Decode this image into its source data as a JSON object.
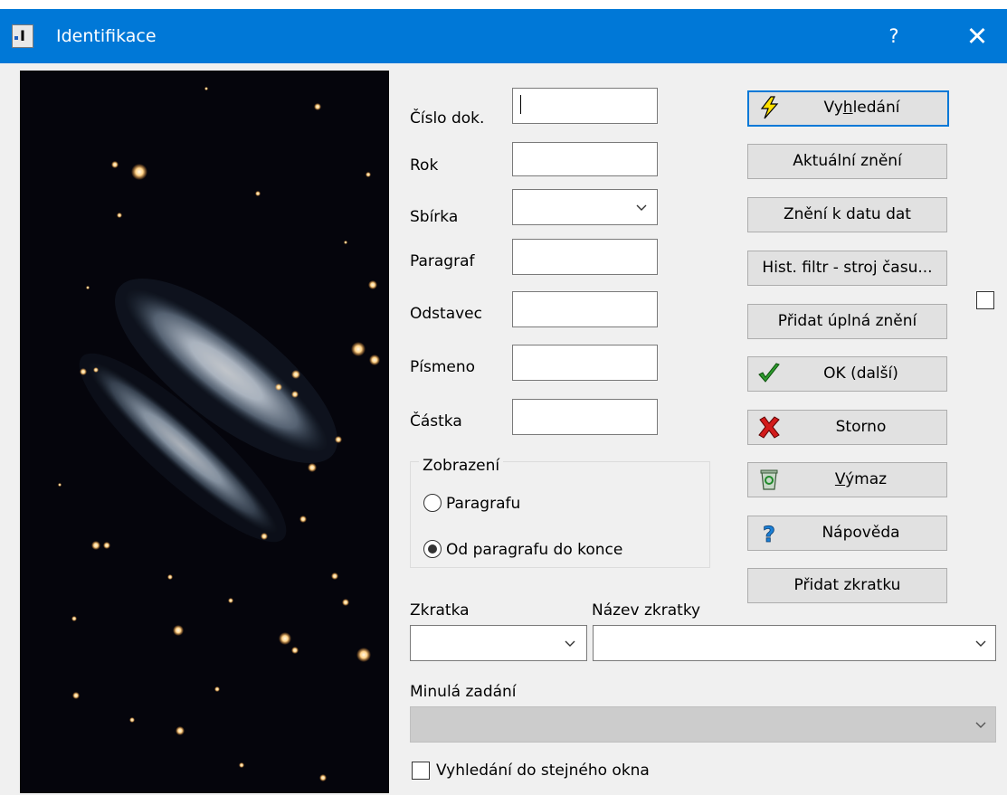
{
  "window": {
    "title": "Identifikace",
    "app_icon_letter": "I",
    "help_glyph": "?",
    "close_glyph": "✕",
    "titlebar_color": "#0078d7"
  },
  "form": {
    "cislo_dok": {
      "label": "Číslo dok.",
      "value": ""
    },
    "rok": {
      "label": "Rok",
      "value": ""
    },
    "sbirka": {
      "label": "Sbírka",
      "value": ""
    },
    "paragraf": {
      "label": "Paragraf",
      "value": ""
    },
    "odstavec": {
      "label": "Odstavec",
      "value": ""
    },
    "pismeno": {
      "label": "Písmeno",
      "value": ""
    },
    "castka": {
      "label": "Částka",
      "value": ""
    }
  },
  "buttons": {
    "vyhledani": {
      "pre": "Vy",
      "accel": "h",
      "post": "ledání",
      "icon": "lightning-icon"
    },
    "aktualni_zneni": "Aktuální znění",
    "zneni_k_datu": "Znění k datu dat",
    "hist_filtr": "Hist. filtr - stroj času...",
    "pridat_uplna": "Přidat úplná znění",
    "ok": {
      "label": "OK (další)",
      "icon": "checkmark-icon"
    },
    "storno": {
      "label": "Storno",
      "icon": "red-x-icon"
    },
    "vymaz": {
      "accel": "V",
      "post": "ýmaz",
      "icon": "recycle-bin-icon"
    },
    "napoveda": {
      "label": "Nápověda",
      "icon": "question-icon"
    },
    "pridat_zkratku": "Přidat zkratku"
  },
  "zobrazeni": {
    "legend": "Zobrazení",
    "options": [
      {
        "label": "Paragrafu",
        "selected": false
      },
      {
        "label": "Od paragrafu do konce",
        "selected": true
      }
    ]
  },
  "zkratka": {
    "label": "Zkratka",
    "value": ""
  },
  "nazev_zkratky": {
    "label": "Název zkratky",
    "value": ""
  },
  "minula_zadani": {
    "label": "Minulá zadání",
    "value": "",
    "disabled": true
  },
  "same_window": {
    "label": "Vyhledání do stejného okna",
    "checked": false
  },
  "side_checkbox": {
    "checked": false
  }
}
